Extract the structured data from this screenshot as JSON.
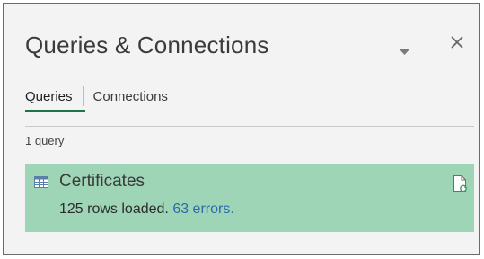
{
  "pane": {
    "title": "Queries & Connections",
    "tabs": [
      {
        "label": "Queries",
        "active": true
      },
      {
        "label": "Connections",
        "active": false
      }
    ],
    "query_count": "1 query"
  },
  "query": {
    "name": "Certificates",
    "rows_loaded": "125 rows loaded.",
    "errors_link": "63 errors."
  },
  "colors": {
    "accent": "#217346",
    "selected_row": "#9fd5b7",
    "link": "#2b6ca9"
  },
  "icons": [
    "chevron-down-icon",
    "close-icon",
    "table-icon",
    "document-refresh-icon"
  ]
}
